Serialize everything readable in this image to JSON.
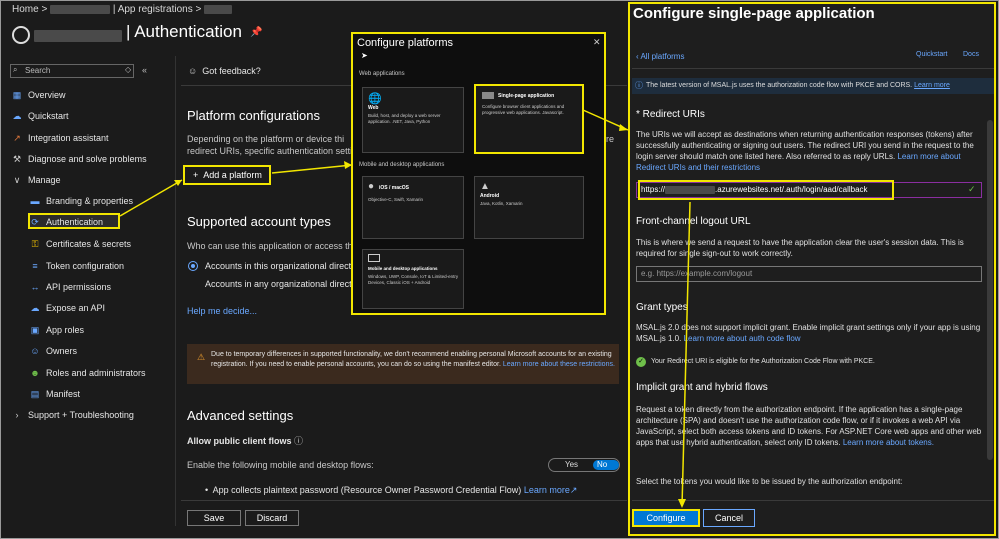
{
  "breadcrumb": {
    "home": "Home",
    "sep": ">",
    "app_registrations": "| App registrations >"
  },
  "header": {
    "title": "| Authentication",
    "pin_icon": "pin-icon"
  },
  "sidebar": {
    "search_placeholder": "Search",
    "items": [
      {
        "label": "Overview",
        "icon": "overview-icon"
      },
      {
        "label": "Quickstart",
        "icon": "quickstart-icon"
      },
      {
        "label": "Integration assistant",
        "icon": "rocket-icon"
      },
      {
        "label": "Diagnose and solve problems",
        "icon": "wrench-icon"
      },
      {
        "label": "Manage",
        "icon": "chevron-down-icon"
      },
      {
        "label": "Branding & properties",
        "icon": "branding-icon"
      },
      {
        "label": "Authentication",
        "icon": "auth-icon"
      },
      {
        "label": "Certificates & secrets",
        "icon": "key-icon"
      },
      {
        "label": "Token configuration",
        "icon": "token-icon"
      },
      {
        "label": "API permissions",
        "icon": "api-icon"
      },
      {
        "label": "Expose an API",
        "icon": "cloud-icon"
      },
      {
        "label": "App roles",
        "icon": "approles-icon"
      },
      {
        "label": "Owners",
        "icon": "owners-icon"
      },
      {
        "label": "Roles and administrators",
        "icon": "roles-icon"
      },
      {
        "label": "Manifest",
        "icon": "manifest-icon"
      },
      {
        "label": "Support + Troubleshooting",
        "icon": "chevron-right-icon"
      }
    ]
  },
  "main": {
    "feedback": "Got feedback?",
    "platform_title": "Platform configurations",
    "platform_desc1": "Depending on the platform or device thi",
    "platform_desc2": "redirect URIs, specific authentication setting",
    "add_platform": "Add a platform",
    "supported_title": "Supported account types",
    "supported_q": "Who can use this application or access thi",
    "opt1": "Accounts in this organizational directo",
    "opt2": "Accounts in any organizational directo",
    "help": "Help me decide...",
    "warning": "Due to temporary differences in supported functionality, we don't recommend enabling personal Microsoft accounts for an existing registration. If you need to enable personal accounts, you can do so using the manifest editor.",
    "warning_link": "Learn more about these restrictions.",
    "advanced_title": "Advanced settings",
    "allow_public": "Allow public client flows",
    "enable_flows": "Enable the following mobile and desktop flows:",
    "toggle_yes": "Yes",
    "toggle_no": "No",
    "bullet": "App collects plaintext password (Resource Owner Password Credential Flow)",
    "learn_more": "Learn more",
    "save": "Save",
    "discard": "Discard"
  },
  "configure_platforms": {
    "title": "Configure platforms",
    "web_section": "Web applications",
    "mobile_section": "Mobile and desktop applications",
    "web": {
      "title": "Web",
      "desc": "Build, host, and deploy a web server application. .NET, Java, Python"
    },
    "spa": {
      "title": "Single-page application",
      "desc": "Configure browser client applications and progressive web applications. Javascript."
    },
    "ios": {
      "title": "iOS / macOS",
      "desc": "Objective-C, Swift, Xamarin"
    },
    "android": {
      "title": "Android",
      "desc": "Java, Kotlin, Xamarin"
    },
    "desktop": {
      "title": "Mobile and desktop applications",
      "desc": "Windows, UWP, Console, IoT & Limited-entry Devices, Classic iOS + Android"
    }
  },
  "spa_panel": {
    "title": "Configure single-page application",
    "back": "All platforms",
    "quickstart": "Quickstart",
    "docs": "Docs",
    "info": "The latest version of MSAL.js uses the authorization code flow with PKCE and CORS.",
    "info_link": "Learn more",
    "redirect_label": "* Redirect URIs",
    "redirect_desc": "The URIs we will accept as destinations when returning authentication responses (tokens) after successfully authenticating or signing out users. The redirect URI you send in the request to the login server should match one listed here. Also referred to as reply URLs.",
    "redirect_link": "Learn more about Redirect URIs and their restrictions",
    "uri_prefix": "https://",
    "uri_suffix": ".azurewebsites.net/.auth/login/aad/callback",
    "logout_title": "Front-channel logout URL",
    "logout_desc": "This is where we send a request to have the application clear the user's session data. This is required for single sign-out to work correctly.",
    "logout_placeholder": "e.g. https://example.com/logout",
    "grant_title": "Grant types",
    "grant_desc": "MSAL.js 2.0 does not support implicit grant. Enable implicit grant settings only if your app is using MSAL.js 1.0.",
    "grant_link": "Learn more about auth code flow",
    "eligible": "Your Redirect URI is eligible for the Authorization Code Flow with PKCE.",
    "implicit_title": "Implicit grant and hybrid flows",
    "implicit_desc": "Request a token directly from the authorization endpoint. If the application has a single-page architecture (SPA) and doesn't use the authorization code flow, or if it invokes a web API via JavaScript, select both access tokens and ID tokens. For ASP.NET Core web apps and other web apps that use hybrid authentication, select only ID tokens.",
    "implicit_link": "Learn more about tokens.",
    "select_tokens": "Select the tokens you would like to be issued by the authorization endpoint:",
    "configure": "Configure",
    "cancel": "Cancel"
  },
  "colors": {
    "highlight": "#f2e600",
    "accent": "#0078d4",
    "link": "#6aa8ff"
  }
}
